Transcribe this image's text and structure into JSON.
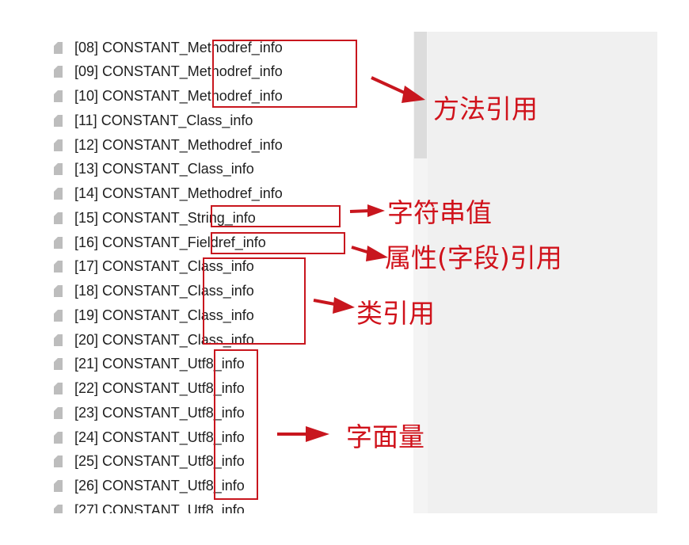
{
  "entries": [
    "[08] CONSTANT_Methodref_info",
    "[09] CONSTANT_Methodref_info",
    "[10] CONSTANT_Methodref_info",
    "[11] CONSTANT_Class_info",
    "[12] CONSTANT_Methodref_info",
    "[13] CONSTANT_Class_info",
    "[14] CONSTANT_Methodref_info",
    "[15] CONSTANT_String_info",
    "[16] CONSTANT_Fieldref_info",
    "[17] CONSTANT_Class_info",
    "[18] CONSTANT_Class_info",
    "[19] CONSTANT_Class_info",
    "[20] CONSTANT_Class_info",
    "[21] CONSTANT_Utf8_info",
    "[22] CONSTANT_Utf8_info",
    "[23] CONSTANT_Utf8_info",
    "[24] CONSTANT_Utf8_info",
    "[25] CONSTANT_Utf8_info",
    "[26] CONSTANT_Utf8_info",
    "[27] CONSTANT_Utf8_info"
  ],
  "annotations": {
    "method_ref": "方法引用",
    "string_value": "字符串值",
    "field_ref": "属性(字段)引用",
    "class_ref": "类引用",
    "literal": "字面量"
  },
  "icons": {
    "entry_icon": "file-icon",
    "arrow_icon": "arrow-right-icon"
  },
  "colors": {
    "annotation_red": "#c8161e",
    "entry_text": "#202020",
    "right_pane_bg": "#f0f0f0"
  }
}
